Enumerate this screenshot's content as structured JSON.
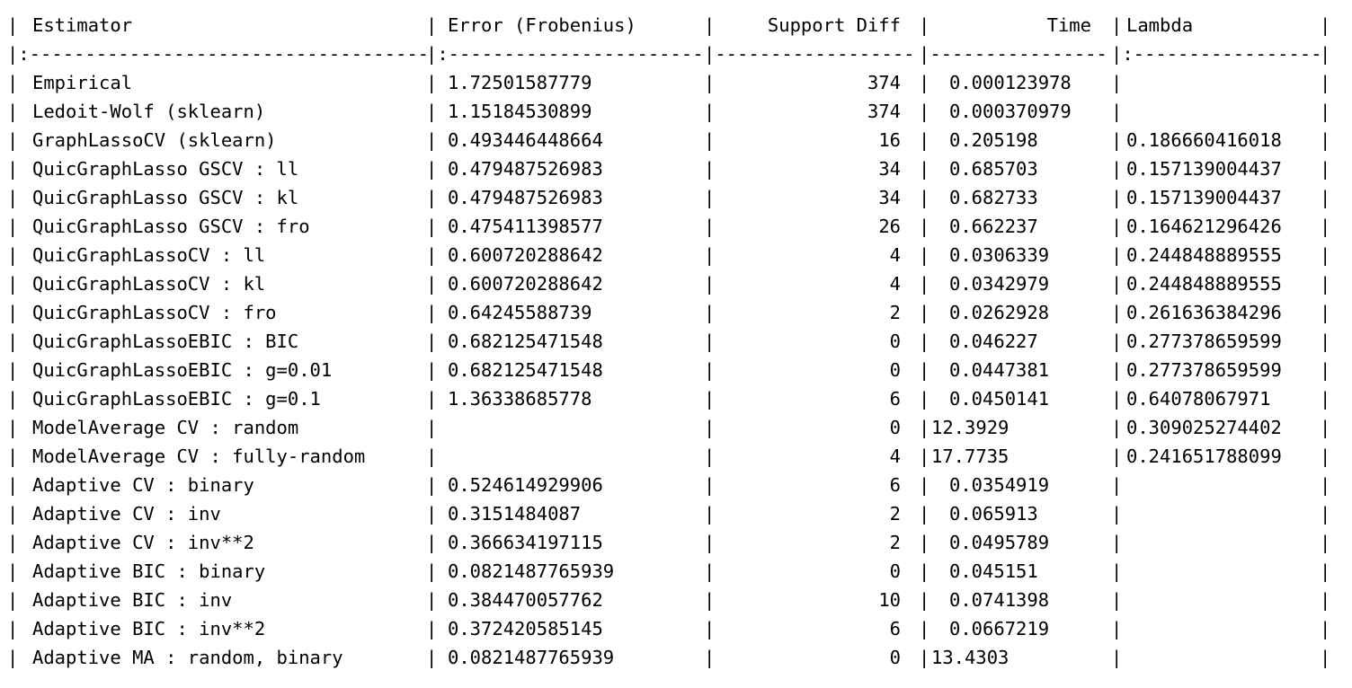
{
  "table": {
    "headers": [
      "Estimator",
      "Error (Frobenius)",
      "Support Diff",
      "Time",
      "Lambda"
    ],
    "separator": "|:------------------------------|:--------------------|--------------:|-------------:|:---------------|",
    "rows": [
      {
        "estimator": "Empirical",
        "error": "1.72501587779",
        "support_diff": "374",
        "time": "0.000123978",
        "lambda": ""
      },
      {
        "estimator": "Ledoit-Wolf (sklearn)",
        "error": "1.15184530899",
        "support_diff": "374",
        "time": "0.000370979",
        "lambda": ""
      },
      {
        "estimator": "GraphLassoCV (sklearn)",
        "error": "0.493446448664",
        "support_diff": "16",
        "time": "0.205198",
        "lambda": "0.186660416018"
      },
      {
        "estimator": "QuicGraphLasso GSCV : ll",
        "error": "0.479487526983",
        "support_diff": "34",
        "time": "0.685703",
        "lambda": "0.157139004437"
      },
      {
        "estimator": "QuicGraphLasso GSCV : kl",
        "error": "0.479487526983",
        "support_diff": "34",
        "time": "0.682733",
        "lambda": "0.157139004437"
      },
      {
        "estimator": "QuicGraphLasso GSCV : fro",
        "error": "0.475411398577",
        "support_diff": "26",
        "time": "0.662237",
        "lambda": "0.164621296426"
      },
      {
        "estimator": "QuicGraphLassoCV : ll",
        "error": "0.600720288642",
        "support_diff": "4",
        "time": "0.0306339",
        "lambda": "0.244848889555"
      },
      {
        "estimator": "QuicGraphLassoCV : kl",
        "error": "0.600720288642",
        "support_diff": "4",
        "time": "0.0342979",
        "lambda": "0.244848889555"
      },
      {
        "estimator": "QuicGraphLassoCV : fro",
        "error": "0.64245588739",
        "support_diff": "2",
        "time": "0.0262928",
        "lambda": "0.261636384296"
      },
      {
        "estimator": "QuicGraphLassoEBIC : BIC",
        "error": "0.682125471548",
        "support_diff": "0",
        "time": "0.046227",
        "lambda": "0.277378659599"
      },
      {
        "estimator": "QuicGraphLassoEBIC : g=0.01",
        "error": "0.682125471548",
        "support_diff": "0",
        "time": "0.0447381",
        "lambda": "0.277378659599"
      },
      {
        "estimator": "QuicGraphLassoEBIC : g=0.1",
        "error": "1.36338685778",
        "support_diff": "6",
        "time": "0.0450141",
        "lambda": "0.64078067971"
      },
      {
        "estimator": "ModelAverage CV : random",
        "error": "",
        "support_diff": "0",
        "time": "12.3929",
        "lambda": "0.309025274402"
      },
      {
        "estimator": "ModelAverage CV : fully-random",
        "error": "",
        "support_diff": "4",
        "time": "17.7735",
        "lambda": "0.241651788099"
      },
      {
        "estimator": "Adaptive CV : binary",
        "error": "0.524614929906",
        "support_diff": "6",
        "time": "0.0354919",
        "lambda": ""
      },
      {
        "estimator": "Adaptive CV : inv",
        "error": "0.3151484087",
        "support_diff": "2",
        "time": "0.065913",
        "lambda": ""
      },
      {
        "estimator": "Adaptive CV : inv**2",
        "error": "0.366634197115",
        "support_diff": "2",
        "time": "0.0495789",
        "lambda": ""
      },
      {
        "estimator": "Adaptive BIC : binary",
        "error": "0.0821487765939",
        "support_diff": "0",
        "time": "0.045151",
        "lambda": ""
      },
      {
        "estimator": "Adaptive BIC : inv",
        "error": "0.384470057762",
        "support_diff": "10",
        "time": "0.0741398",
        "lambda": ""
      },
      {
        "estimator": "Adaptive BIC : inv**2",
        "error": "0.372420585145",
        "support_diff": "6",
        "time": "0.0667219",
        "lambda": ""
      },
      {
        "estimator": "Adaptive MA : random, binary",
        "error": "0.0821487765939",
        "support_diff": "0",
        "time": "13.4303",
        "lambda": ""
      }
    ]
  }
}
